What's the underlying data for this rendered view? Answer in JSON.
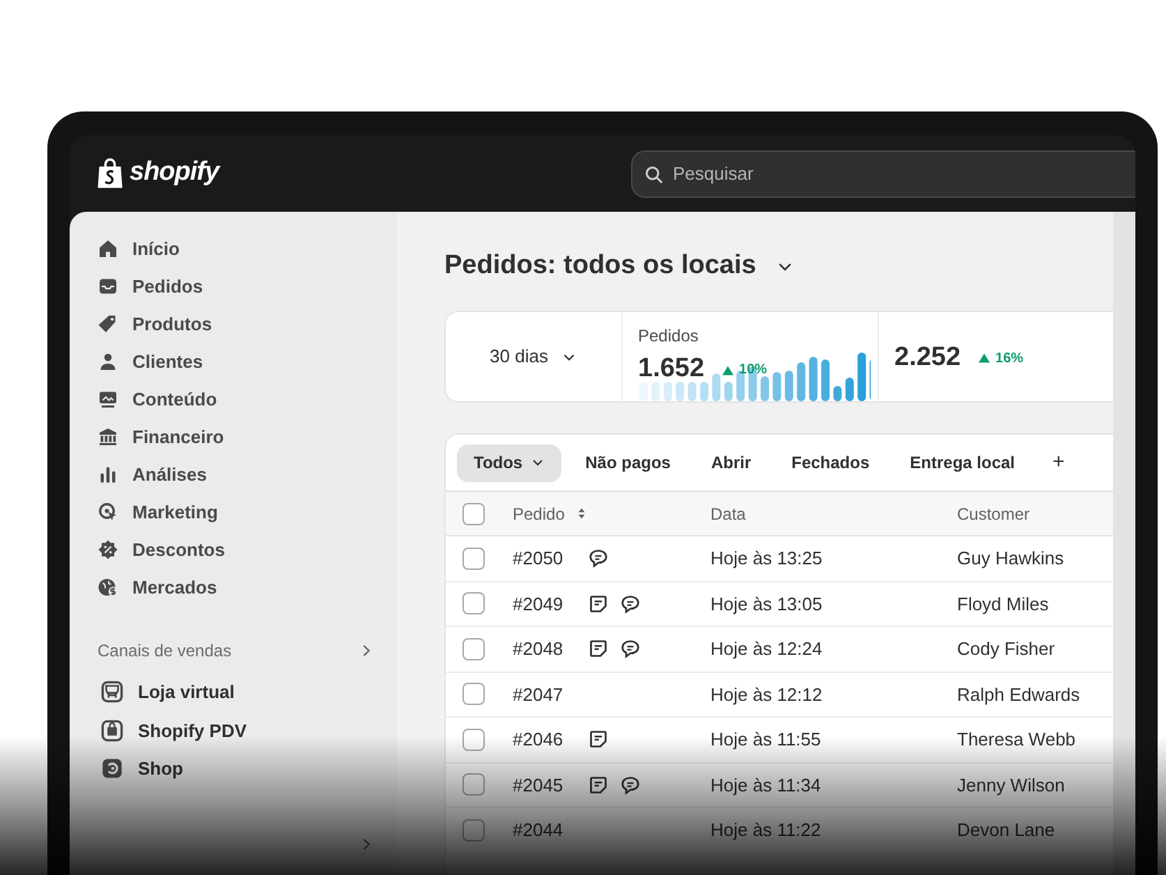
{
  "header": {
    "logo": "shopify",
    "search": {
      "placeholder": "Pesquisar"
    }
  },
  "sidebar": {
    "items": [
      {
        "label": "Início"
      },
      {
        "label": "Pedidos"
      },
      {
        "label": "Produtos"
      },
      {
        "label": "Clientes"
      },
      {
        "label": "Conteúdo"
      },
      {
        "label": "Financeiro"
      },
      {
        "label": "Análises"
      },
      {
        "label": "Marketing"
      },
      {
        "label": "Descontos"
      },
      {
        "label": "Mercados"
      }
    ],
    "sales_channels": {
      "title": "Canais de vendas",
      "items": [
        {
          "label": "Loja virtual"
        },
        {
          "label": "Shopify PDV"
        },
        {
          "label": "Shop"
        }
      ]
    }
  },
  "page_title": "Pedidos: todos os locais",
  "stats": {
    "period": "30 dias",
    "metrics": [
      {
        "label": "Pedidos",
        "value": "1.652",
        "change": "10%"
      },
      {
        "value": "2.252",
        "change": "16%"
      }
    ]
  },
  "filters": {
    "tabs": [
      {
        "label": "Todos",
        "selected": true
      },
      {
        "label": "Não pagos",
        "selected": false
      },
      {
        "label": "Abrir",
        "selected": false
      },
      {
        "label": "Fechados",
        "selected": false
      },
      {
        "label": "Entrega local",
        "selected": false
      }
    ],
    "add": "+"
  },
  "table": {
    "select_all_checked": false,
    "columns": [
      {
        "label": "Pedido"
      },
      {
        "label": "Data"
      },
      {
        "label": "Customer"
      }
    ],
    "rows": [
      {
        "order": "#2050",
        "note": false,
        "comment": true,
        "date": "Hoje às 13:25",
        "customer": "Guy Hawkins",
        "checked": false
      },
      {
        "order": "#2049",
        "note": true,
        "comment": true,
        "date": "Hoje às 13:05",
        "customer": "Floyd Miles",
        "checked": false
      },
      {
        "order": "#2048",
        "note": true,
        "comment": true,
        "date": "Hoje às 12:24",
        "customer": "Cody Fisher",
        "checked": false
      },
      {
        "order": "#2047",
        "note": false,
        "comment": false,
        "date": "Hoje às 12:12",
        "customer": "Ralph Edwards",
        "checked": false
      },
      {
        "order": "#2046",
        "note": true,
        "comment": false,
        "date": "Hoje às 11:55",
        "customer": "Theresa Webb",
        "checked": false
      },
      {
        "order": "#2045",
        "note": true,
        "comment": true,
        "date": "Hoje às 11:34",
        "customer": "Jenny Wilson",
        "checked": false
      },
      {
        "order": "#2044",
        "note": false,
        "comment": false,
        "date": "Hoje às 11:22",
        "customer": "Devon Lane",
        "checked": false
      }
    ]
  }
}
